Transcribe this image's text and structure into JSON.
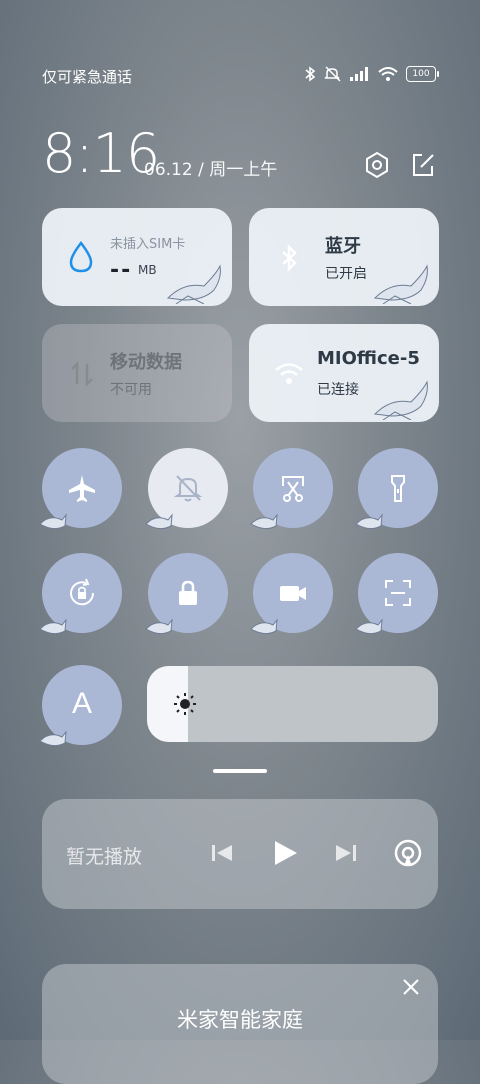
{
  "status": {
    "carrier": "仅可紧急通话",
    "battery": "100"
  },
  "header": {
    "time": "8:16",
    "date": "06.12 / 周一上午"
  },
  "cards": {
    "sim": {
      "label": "未插入SIM卡",
      "value": "--",
      "unit": "MB"
    },
    "bluetooth": {
      "title": "蓝牙",
      "status": "已开启"
    },
    "mobile_data": {
      "title": "移动数据",
      "status": "不可用"
    },
    "wifi": {
      "title": "MIOffice-5",
      "status": "已连接"
    }
  },
  "toggles": [
    {
      "name": "airplane",
      "active": false
    },
    {
      "name": "mute",
      "active": true
    },
    {
      "name": "screenshot",
      "active": false
    },
    {
      "name": "flashlight",
      "active": false
    },
    {
      "name": "auto-rotate",
      "active": false
    },
    {
      "name": "lock",
      "active": false
    },
    {
      "name": "screen-record",
      "active": false
    },
    {
      "name": "scanner",
      "active": false
    },
    {
      "name": "auto-brightness",
      "label": "A",
      "active": false
    }
  ],
  "brightness": {
    "level_percent": 14
  },
  "media": {
    "label": "暂无播放"
  },
  "smart_home": {
    "title": "米家智能家庭"
  },
  "colors": {
    "tile": "#aab8d6",
    "tile_active": "#e7ebf1",
    "card": "#ecf1f7"
  }
}
